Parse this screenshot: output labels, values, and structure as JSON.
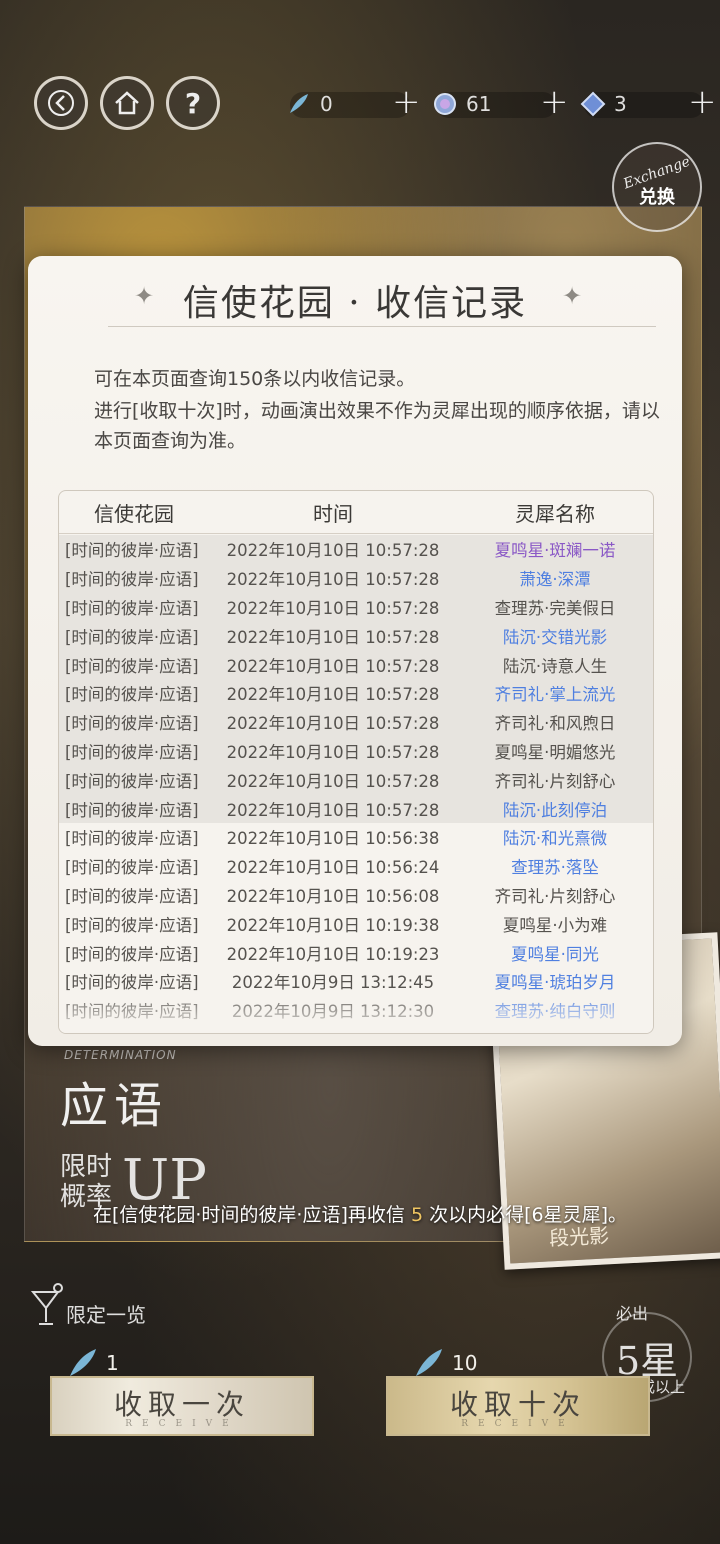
{
  "header": {
    "resources": [
      {
        "name": "feather",
        "value": "0"
      },
      {
        "name": "orb",
        "value": "61"
      },
      {
        "name": "crystal",
        "value": "3"
      }
    ],
    "exchange_script": "Exchange",
    "exchange_label": "兑换"
  },
  "modal": {
    "title": "信使花园 · 收信记录",
    "desc_line1": "可在本页面查询150条以内收信记录。",
    "desc_line2": "进行[收取十次]时，动画演出效果不作为灵犀出现的顺序依据，请以本页面查询为准。",
    "columns": [
      "信使花园",
      "时间",
      "灵犀名称"
    ],
    "rows": [
      {
        "garden": "[时间的彼岸·应语]",
        "time": "2022年10月10日 10:57:28",
        "name": "夏鸣星·斑斓一诺",
        "color": "#8a58c6"
      },
      {
        "garden": "[时间的彼岸·应语]",
        "time": "2022年10月10日 10:57:28",
        "name": "萧逸·深潭",
        "color": "#4f7fe0"
      },
      {
        "garden": "[时间的彼岸·应语]",
        "time": "2022年10月10日 10:57:28",
        "name": "查理苏·完美假日",
        "color": "#55524e"
      },
      {
        "garden": "[时间的彼岸·应语]",
        "time": "2022年10月10日 10:57:28",
        "name": "陆沉·交错光影",
        "color": "#4f7fe0"
      },
      {
        "garden": "[时间的彼岸·应语]",
        "time": "2022年10月10日 10:57:28",
        "name": "陆沉·诗意人生",
        "color": "#55524e"
      },
      {
        "garden": "[时间的彼岸·应语]",
        "time": "2022年10月10日 10:57:28",
        "name": "齐司礼·掌上流光",
        "color": "#4f7fe0"
      },
      {
        "garden": "[时间的彼岸·应语]",
        "time": "2022年10月10日 10:57:28",
        "name": "齐司礼·和风煦日",
        "color": "#55524e"
      },
      {
        "garden": "[时间的彼岸·应语]",
        "time": "2022年10月10日 10:57:28",
        "name": "夏鸣星·明媚悠光",
        "color": "#55524e"
      },
      {
        "garden": "[时间的彼岸·应语]",
        "time": "2022年10月10日 10:57:28",
        "name": "齐司礼·片刻舒心",
        "color": "#55524e"
      },
      {
        "garden": "[时间的彼岸·应语]",
        "time": "2022年10月10日 10:57:28",
        "name": "陆沉·此刻停泊",
        "color": "#4f7fe0"
      },
      {
        "garden": "[时间的彼岸·应语]",
        "time": "2022年10月10日 10:56:38",
        "name": "陆沉·和光熹微",
        "color": "#4f7fe0"
      },
      {
        "garden": "[时间的彼岸·应语]",
        "time": "2022年10月10日 10:56:24",
        "name": "查理苏·落坠",
        "color": "#4f7fe0"
      },
      {
        "garden": "[时间的彼岸·应语]",
        "time": "2022年10月10日 10:56:08",
        "name": "齐司礼·片刻舒心",
        "color": "#55524e"
      },
      {
        "garden": "[时间的彼岸·应语]",
        "time": "2022年10月10日 10:19:38",
        "name": "夏鸣星·小为难",
        "color": "#55524e"
      },
      {
        "garden": "[时间的彼岸·应语]",
        "time": "2022年10月10日 10:19:23",
        "name": "夏鸣星·同光",
        "color": "#4f7fe0"
      },
      {
        "garden": "[时间的彼岸·应语]",
        "time": "2022年10月9日 13:12:45",
        "name": "夏鸣星·琥珀岁月",
        "color": "#4f7fe0"
      },
      {
        "garden": "[时间的彼岸·应语]",
        "time": "2022年10月9日 13:12:30",
        "name": "查理苏·纯白守则",
        "color": "#4f7fe0"
      }
    ]
  },
  "banner": {
    "determination": "DETERMINATION",
    "ying_yu": "应语",
    "limit_time": "限时概率",
    "up": "UP",
    "card_name": "段光影"
  },
  "notice": {
    "prefix": "在[信使花园·时间的彼岸·应语]再收信",
    "count": "5",
    "suffix": "次以内必得[6星灵犀]。"
  },
  "bottom": {
    "limited_label": "限定一览",
    "guarantee_top": "必出",
    "guarantee_main": "5星",
    "guarantee_bottom": "或以上",
    "once_cost": "1",
    "ten_cost": "10",
    "once_label": "收取一次",
    "ten_label": "收取十次",
    "btn_sub": "RECEIVE"
  }
}
